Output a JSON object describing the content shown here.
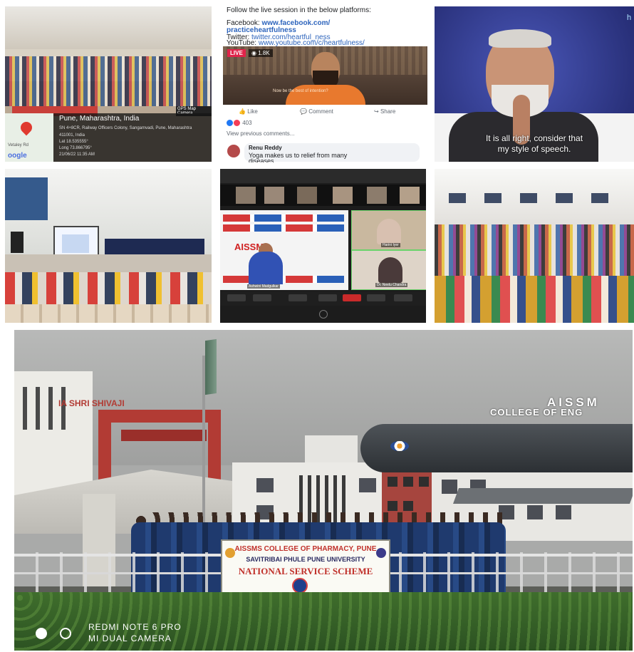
{
  "tile_geotag": {
    "place": "Pune, Maharashtra, India",
    "address": "SN 4+8CR, Railway Officers Colony, Sangamvadi, Pune, Maharashtra",
    "pin": "411001, India",
    "lat": "Lat 18.535555°",
    "long": "Long 73.866795°",
    "datetime": "21/06/22 11:35 AM",
    "map_road": "Vetaley Rd",
    "map_logo": "oogle",
    "badge": "GPS Map Camera"
  },
  "tile_facebook": {
    "intro": "Follow the live session in the below platforms:",
    "facebook_label": "Facebook:",
    "facebook_url": "www.facebook.com/",
    "facebook_url2": "practiceheartfulness",
    "twitter_label": "Twitter:",
    "twitter_url": "twitter.com/heartful_ness",
    "youtube_label": "YouTube:",
    "youtube_url": "www.youtube.com/c/heartfulness/",
    "live": "LIVE",
    "views": "1.8K",
    "video_caption": "Now be the best of intention?",
    "like": "Like",
    "comment": "Comment",
    "share": "Share",
    "reactions": "403",
    "view_previous": "View previous comments...",
    "commenter": "Renu Reddy",
    "comment_text1": "Yoga makes us to relief from many",
    "comment_text2": "diseases"
  },
  "tile_speaker": {
    "subtitle1": "It is all right, consider that",
    "subtitle2": "my style of speech.",
    "corner": "h"
  },
  "tile_zoom": {
    "logo": "AISSMS",
    "presenter_name": "Ashwini Madgulkar",
    "p1_name": "Harini Iyer",
    "p2_name": "Dr. Neelu Chandra"
  },
  "campus": {
    "sign_left": "IA SHRI SHIVAJI",
    "college_sign1": "AISSM",
    "college_sign2": "COLLEGE OF ENG",
    "banner_line1": "AISSMS COLLEGE OF PHARMACY, PUNE",
    "banner_line2": "SAVITRIBAI PHULE PUNE UNIVERSITY",
    "banner_line3": "NATIONAL SERVICE SCHEME",
    "watermark1": "REDMI NOTE 6 PRO",
    "watermark2": "MI DUAL CAMERA"
  },
  "colors": {
    "facebook_link": "#2d64bc",
    "live_red": "#e0244a",
    "banner_red": "#c0302a",
    "shirt_navy": "#1f3a6e"
  }
}
